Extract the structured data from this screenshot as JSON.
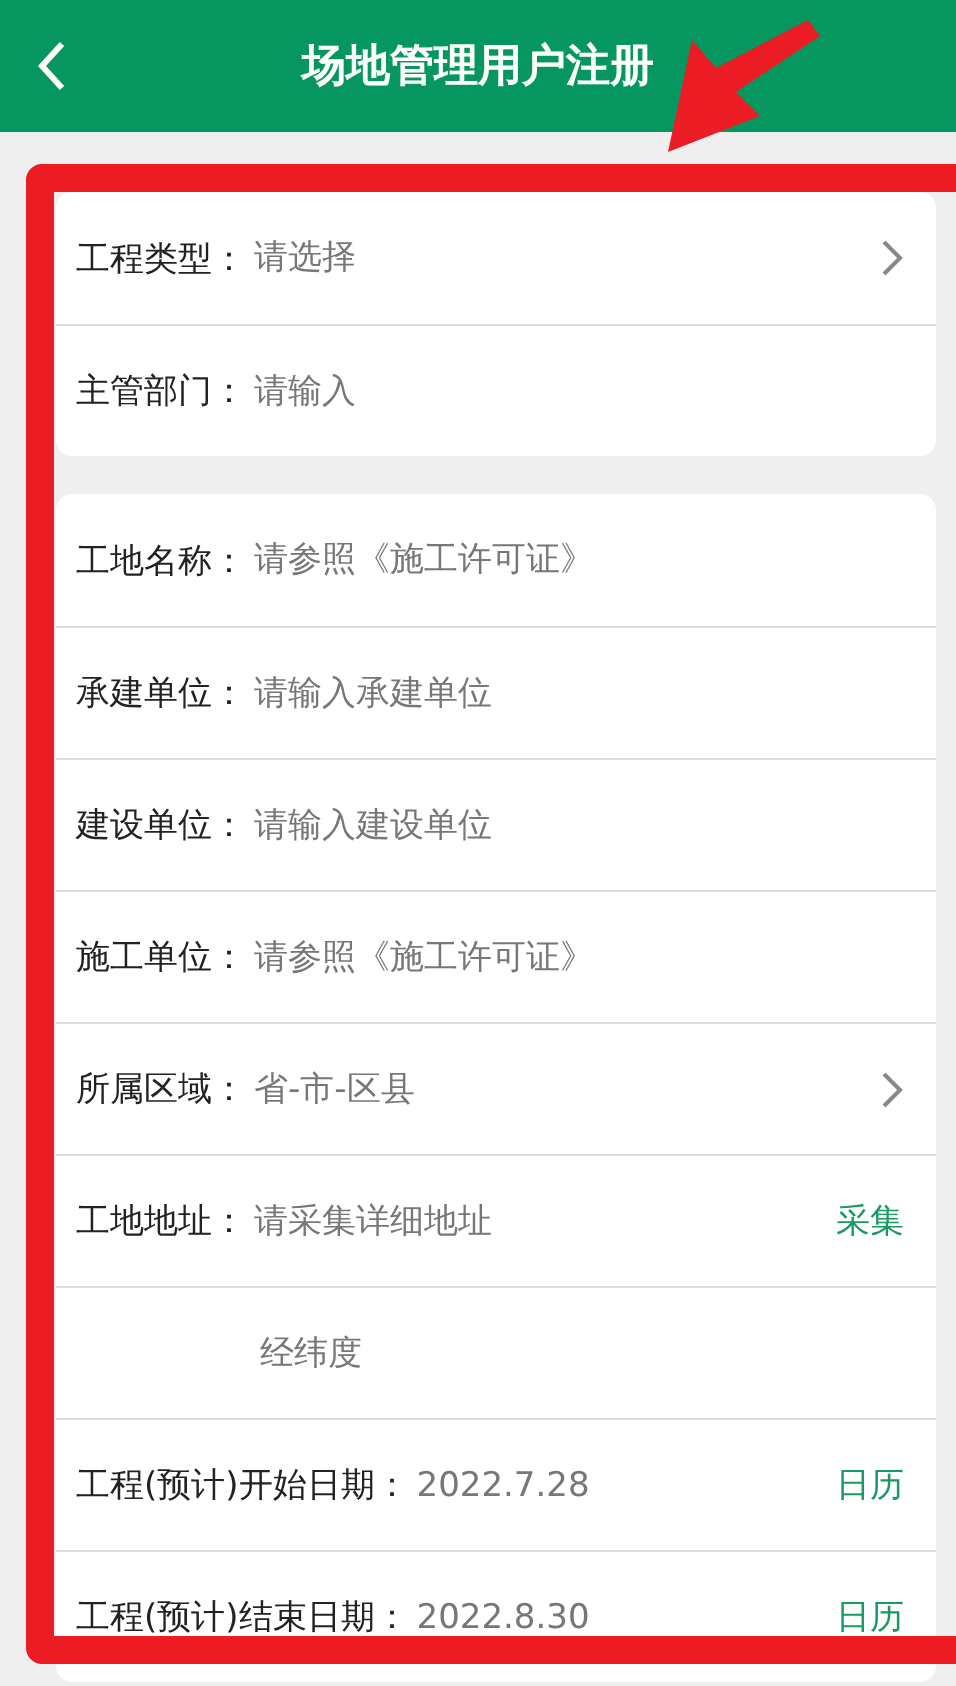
{
  "header": {
    "title": "场地管理用户注册"
  },
  "sections": [
    {
      "rows": [
        {
          "kind": "select",
          "label": "工程类型：",
          "placeholder": "请选择"
        },
        {
          "kind": "plain",
          "label": "主管部门：",
          "placeholder": "请输入"
        }
      ]
    },
    {
      "rows": [
        {
          "kind": "plain",
          "label": "工地名称：",
          "placeholder": "请参照《施工许可证》"
        },
        {
          "kind": "plain",
          "label": "承建单位：",
          "placeholder": "请输入承建单位"
        },
        {
          "kind": "plain",
          "label": "建设单位：",
          "placeholder": "请输入建设单位"
        },
        {
          "kind": "plain",
          "label": "施工单位：",
          "placeholder": "请参照《施工许可证》"
        },
        {
          "kind": "select",
          "label": "所属区域：",
          "placeholder": "省-市-区县"
        },
        {
          "kind": "action",
          "label": "工地地址：",
          "placeholder": "请采集详细地址",
          "action": "采集"
        },
        {
          "kind": "indent",
          "placeholder": "经纬度"
        },
        {
          "kind": "action",
          "label": "工程(预计)开始日期：",
          "value": "2022.7.28",
          "action": "日历"
        },
        {
          "kind": "action",
          "label": "工程(预计)结束日期：",
          "value": "2022.8.30",
          "action": "日历"
        }
      ]
    }
  ]
}
